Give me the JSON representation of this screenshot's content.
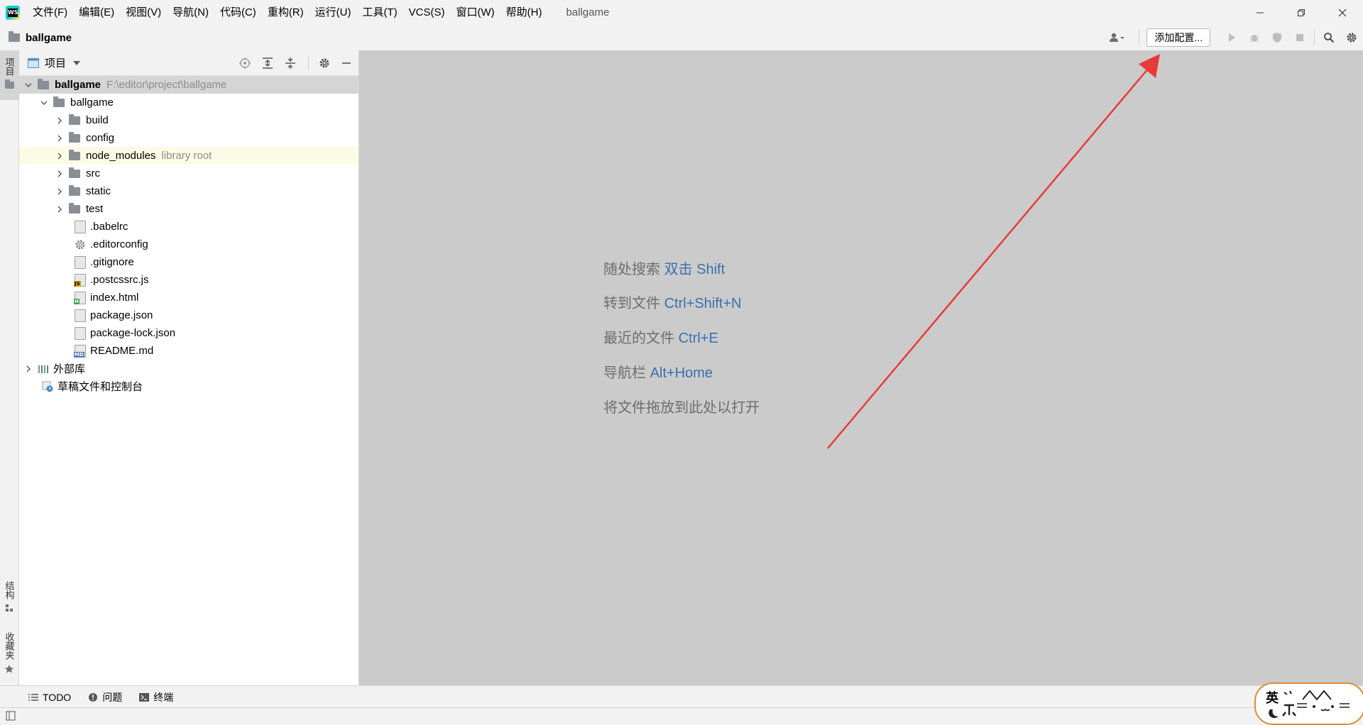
{
  "titlebar": {
    "logo_text": "WS",
    "menu": [
      "文件(F)",
      "编辑(E)",
      "视图(V)",
      "导航(N)",
      "代码(C)",
      "重构(R)",
      "运行(U)",
      "工具(T)",
      "VCS(S)",
      "窗口(W)",
      "帮助(H)"
    ],
    "window_title": "ballgame"
  },
  "navbar": {
    "breadcrumb": "ballgame",
    "add_config_label": "添加配置..."
  },
  "left_strip": {
    "project_tab": "项目",
    "structure_tab": "结构",
    "favorites_tab": "收藏夹"
  },
  "panel": {
    "title": "项目"
  },
  "tree": {
    "root": {
      "name": "ballgame",
      "path": "F:\\editor\\project\\ballgame"
    },
    "inner": "ballgame",
    "folders": [
      "build",
      "config",
      "node_modules",
      "src",
      "static",
      "test"
    ],
    "library_root_note": "library root",
    "files": [
      ".babelrc",
      ".editorconfig",
      ".gitignore",
      ".postcssrc.js",
      "index.html",
      "package.json",
      "package-lock.json",
      "README.md"
    ],
    "external_libs": "外部库",
    "scratches": "草稿文件和控制台"
  },
  "editor": {
    "hints": [
      {
        "text": "随处搜索",
        "key": "双击 Shift"
      },
      {
        "text": "转到文件",
        "key": "Ctrl+Shift+N"
      },
      {
        "text": "最近的文件",
        "key": "Ctrl+E"
      },
      {
        "text": "导航栏",
        "key": "Alt+Home"
      },
      {
        "text": "将文件拖放到此处以打开",
        "key": ""
      }
    ]
  },
  "bottom_tabs": {
    "todo": "TODO",
    "problems": "问题",
    "terminal": "终端"
  },
  "mascot_text": "英",
  "colors": {
    "annotation_arrow": "#e83a3a",
    "hint_key": "#3a70ad",
    "editor_bg": "#cbcbcb"
  }
}
